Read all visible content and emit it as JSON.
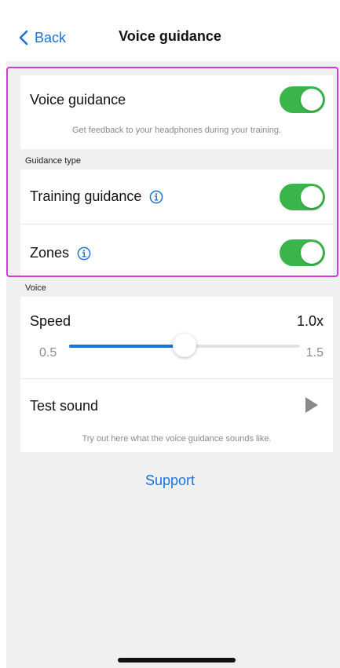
{
  "nav": {
    "back_label": "Back",
    "title": "Voice guidance"
  },
  "voice_guidance": {
    "label": "Voice guidance",
    "enabled": true,
    "description": "Get feedback to your headphones during your training."
  },
  "guidance_type": {
    "section_label": "Guidance type",
    "items": [
      {
        "label": "Training guidance",
        "enabled": true
      },
      {
        "label": "Zones",
        "enabled": true
      }
    ]
  },
  "voice": {
    "section_label": "Voice",
    "speed": {
      "label": "Speed",
      "value_text": "1.0x",
      "min_label": "0.5",
      "max_label": "1.5",
      "min": 0.5,
      "max": 1.5,
      "value": 1.0
    },
    "test_sound": {
      "label": "Test sound",
      "description": "Try out here what the voice guidance sounds like."
    }
  },
  "support_label": "Support",
  "colors": {
    "accent": "#1a73d9",
    "toggle_on": "#3ab54a",
    "highlight": "#d63ad6",
    "background": "#f0f0f0"
  },
  "icons": {
    "back": "chevron-left-icon",
    "info": "info-icon",
    "play": "play-icon"
  }
}
